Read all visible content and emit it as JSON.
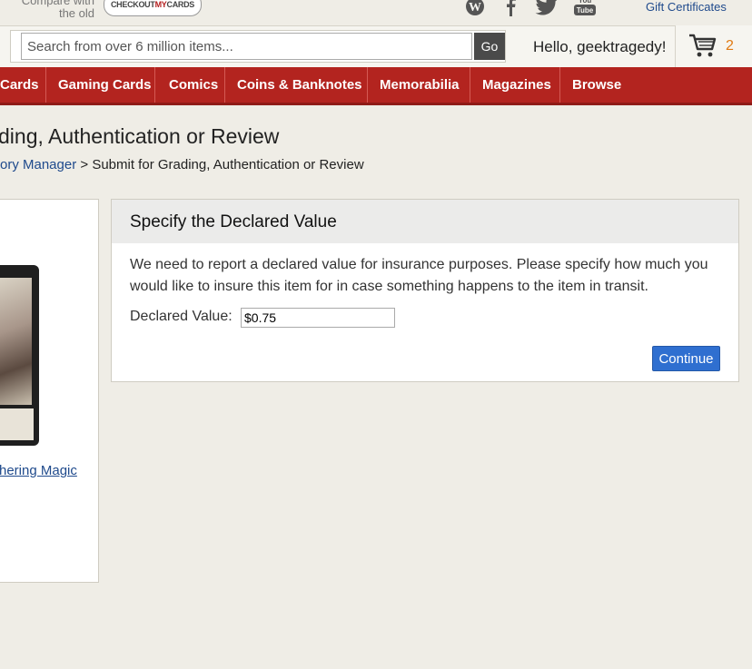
{
  "topbar": {
    "compare_line1": "Compare with",
    "compare_line2": "the old",
    "logo_part1": "CHECKOUT",
    "logo_part2": "MY",
    "logo_part3": "CARDS",
    "social_icons": [
      "wordpress-icon",
      "facebook-icon",
      "twitter-icon",
      "youtube-icon"
    ],
    "youtube_text": "You Tube",
    "gift_link": "Gift Certificates"
  },
  "header": {
    "search_placeholder": "Search from over 6 million items...",
    "search_value": "",
    "go_label": "Go",
    "greeting": "Hello, geektragedy!",
    "cart_count": "2"
  },
  "nav": {
    "items": [
      "Cards",
      "Gaming Cards",
      "Comics",
      "Coins & Banknotes",
      "Memorabilia",
      "Magazines",
      "Browse"
    ]
  },
  "page": {
    "title": "ding, Authentication or Review",
    "breadcrumb_link": "ory Manager",
    "breadcrumb_sep": ">",
    "breadcrumb_current": "Submit for Grading, Authentication or Review"
  },
  "card": {
    "link_text": "hering Magic"
  },
  "declared_value": {
    "title": "Specify the Declared Value",
    "body": "We need to report a declared value for insurance purposes. Please specify how much you would like to insure this item for in case something happens to the item in transit.",
    "label": "Declared Value:",
    "value": "$0.75",
    "continue_label": "Continue"
  },
  "colors": {
    "nav_red": "#b3241f",
    "link_blue": "#1f4a8c",
    "cart_orange": "#e07a12",
    "button_blue": "#2f6fd0"
  }
}
